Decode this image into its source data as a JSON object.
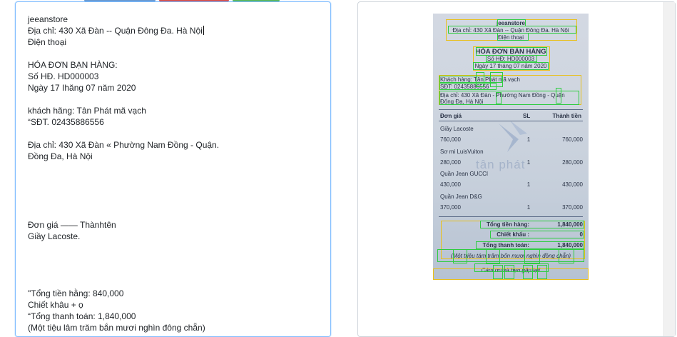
{
  "editor": {
    "lines": [
      "jeeanstore",
      "Địa chỉ: 430 Xã Đàn -- Quận Đông Đa. Hà Nội",
      "Điện thoại",
      "",
      "HÓA ĐƠN BẠN HÀNG:",
      "Số HĐ. HD000003",
      "Ngày 17 Ihăng 07 năm 2020",
      "",
      "khách hãng: Tân Phát mã vạch",
      "“SĐT. 02435886556",
      "",
      "Địa chỉ: 430 Xã Đàn « Phường Nam Đồng - Quận.",
      "Đồng Đa, Hà Nội",
      "",
      "",
      "",
      "",
      "",
      "Đơn giá ——  Thànhtên",
      "Giầy Lacoste.",
      "",
      "",
      "",
      "",
      "\"Tổng tiền hằng: 840,000",
      "Chiết khâu + ọ",
      "“Tổng thanh toán: 1,840,000",
      "(Một tiệu lâm trăm bắn mươi nghìn đông chẵn)"
    ]
  },
  "receipt": {
    "store": "jeeanstore",
    "address": "Địa chỉ: 430 Xã Đàn -- Quận Đông Đa. Hà Nội",
    "phone": "Điện thoại",
    "title": "HÓA ĐƠN BÁN HÀNG",
    "invoice_no": "Số HĐ: HD000003",
    "date": "Ngày 17 tháng 07 năm 2020",
    "customer": "Khách hàng: Tân Phát mã vạch",
    "customer_phone": "SĐT: 02435886556",
    "customer_address_1": "Địa chỉ: 430 Xã Đàn - Phường Nam Đồng - Quận",
    "customer_address_2": "Đống Đa, Hà Nội",
    "col_price": "Đơn giá",
    "col_qty": "SL",
    "col_total": "Thành tiền",
    "items": [
      {
        "name": "Giầy Lacoste",
        "price": "760,000",
        "qty": "1",
        "total": "760,000"
      },
      {
        "name": "Sơ mi LuisVuiton",
        "price": "280,000",
        "qty": "1",
        "total": "280,000"
      },
      {
        "name": "Quần Jean GUCCI",
        "price": "430,000",
        "qty": "1",
        "total": "430,000"
      },
      {
        "name": "Quần Jean D&G",
        "price": "370,000",
        "qty": "1",
        "total": "370,000"
      }
    ],
    "subtotal_label": "Tổng tiền hàng:",
    "subtotal": "1,840,000",
    "discount_label": "Chiết khấu :",
    "discount": "0",
    "grand_label": "Tổng thanh toán:",
    "grand": "1,840,000",
    "in_words": "(Một triệu tám trăm bốn mươi nghìn đồng chẵn)",
    "thanks": "Cám ơn và hẹn gặp lại!",
    "watermark": "tân phát"
  },
  "colors": {
    "editor_border": "#80bdff",
    "ocr_line_box": "#2ecc40",
    "ocr_block_box": "#e8c01c",
    "top_button_1": "#6c9bd2",
    "top_button_2": "#d9534f",
    "top_button_3": "#5cb85c"
  }
}
